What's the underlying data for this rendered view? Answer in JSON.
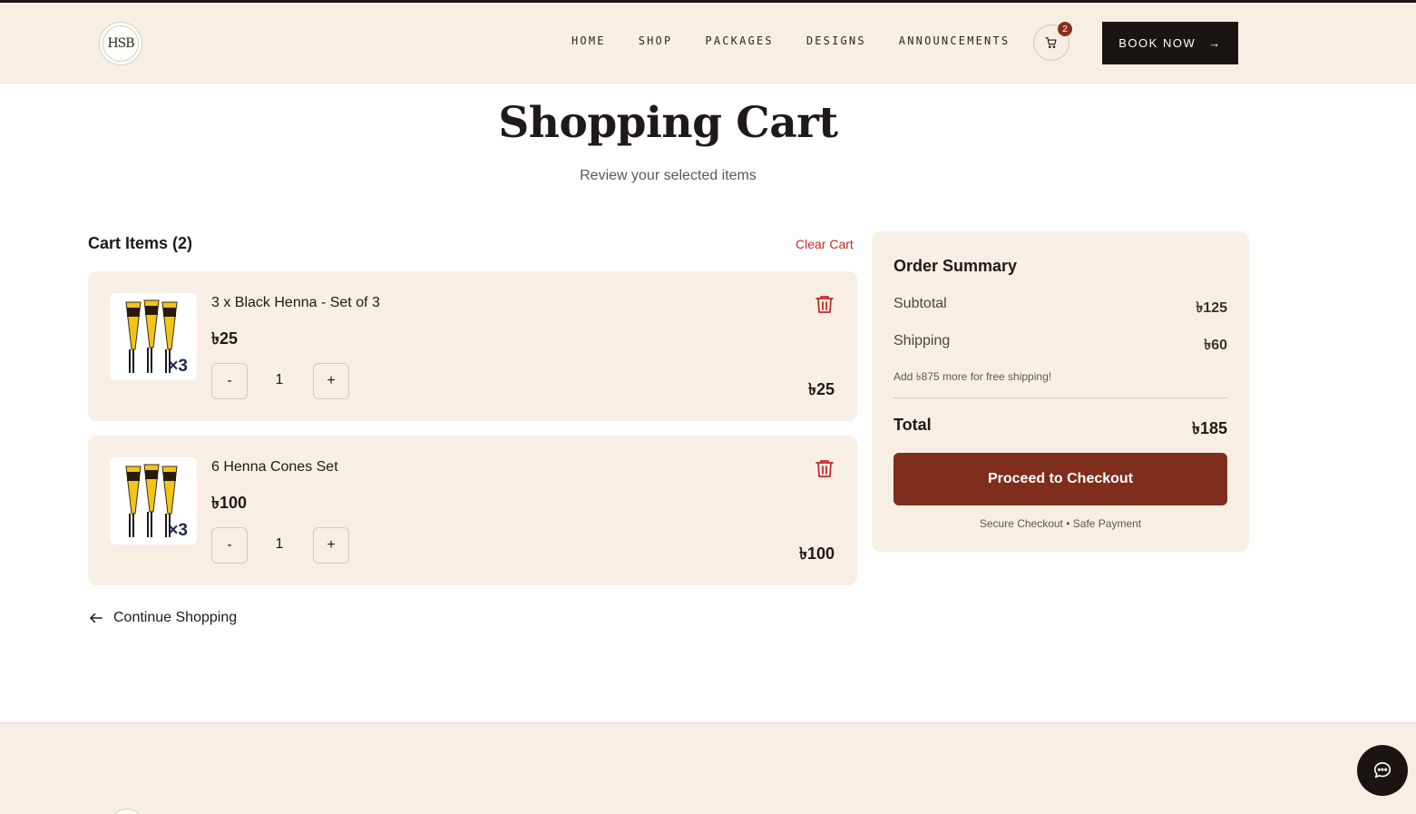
{
  "header": {
    "logo_text": "HSB",
    "nav": [
      "HOME",
      "SHOP",
      "PACKAGES",
      "DESIGNS",
      "ANNOUNCEMENTS"
    ],
    "cart_count": "2",
    "book_now": "BOOK NOW",
    "book_arrow": "→"
  },
  "page": {
    "title": "Shopping Cart",
    "subtitle": "Review your selected items"
  },
  "cart": {
    "heading": "Cart Items (2)",
    "clear_label": "Clear Cart",
    "items": [
      {
        "name": "3 x Black Henna - Set of 3",
        "price": "৳25",
        "qty": "1",
        "line_total": "৳25",
        "thumb_mult": "×3"
      },
      {
        "name": "6 Henna Cones Set",
        "price": "৳100",
        "qty": "1",
        "line_total": "৳100",
        "thumb_mult": "×3"
      }
    ],
    "minus_label": "-",
    "plus_label": "+",
    "continue_label": "Continue Shopping"
  },
  "summary": {
    "title": "Order Summary",
    "subtotal_label": "Subtotal",
    "subtotal_value": "৳125",
    "shipping_label": "Shipping",
    "shipping_value": "৳60",
    "free_shipping_note": "Add ৳875 more for free shipping!",
    "total_label": "Total",
    "total_value": "৳185",
    "checkout_label": "Proceed to Checkout",
    "secure_note": "Secure Checkout • Safe Payment"
  },
  "icons": {
    "cart": "cart-icon",
    "trash": "trash-icon",
    "back_arrow": "arrow-left-icon",
    "chat": "chat-bubble-icon"
  },
  "colors": {
    "cream": "#f7efe4",
    "accent": "#7f2d1d",
    "danger": "#c62828",
    "dark": "#1b1512"
  }
}
